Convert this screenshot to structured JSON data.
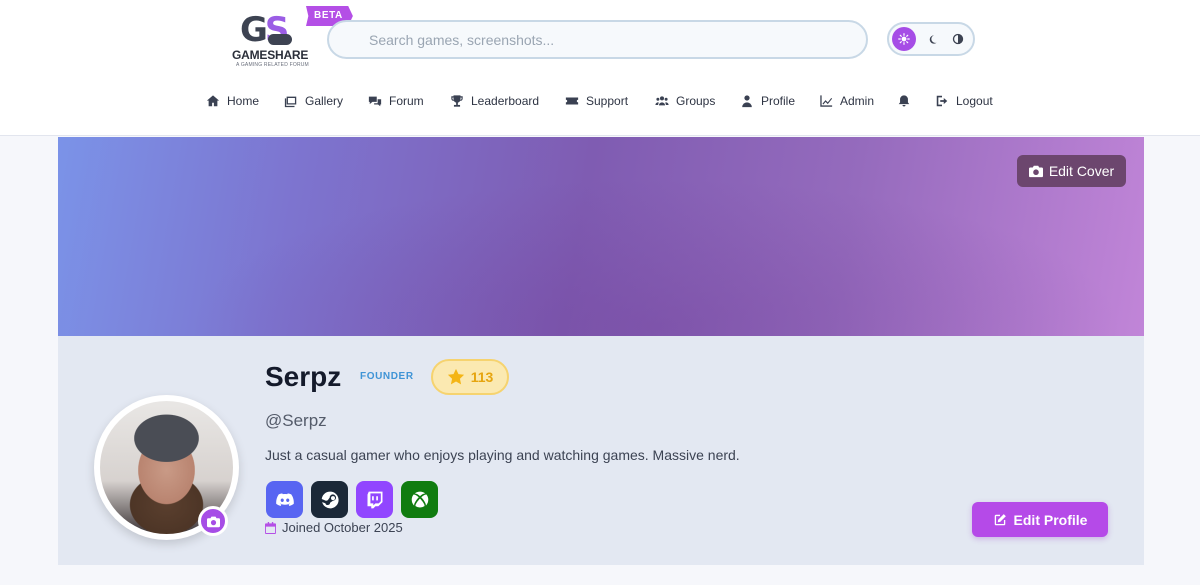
{
  "header": {
    "logo": {
      "mark": "GS",
      "name": "GAMESHARE",
      "tagline": "A GAMING RELATED FORUM"
    },
    "beta_badge": "BETA",
    "search": {
      "placeholder": "Search games, screenshots...",
      "value": ""
    },
    "theme_toggle": {
      "options": [
        "light",
        "dark",
        "auto"
      ],
      "selected": "light"
    }
  },
  "nav": {
    "items": [
      {
        "label": "Home",
        "icon": "home-icon"
      },
      {
        "label": "Gallery",
        "icon": "images-icon"
      },
      {
        "label": "Forum",
        "icon": "comments-icon"
      },
      {
        "label": "Leaderboard",
        "icon": "trophy-icon"
      },
      {
        "label": "Support",
        "icon": "ticket-icon"
      },
      {
        "label": "Groups",
        "icon": "users-icon"
      },
      {
        "label": "Profile",
        "icon": "user-icon"
      },
      {
        "label": "Admin",
        "icon": "chart-icon"
      },
      {
        "label": "",
        "icon": "bell-icon"
      },
      {
        "label": "Logout",
        "icon": "logout-icon"
      }
    ]
  },
  "cover": {
    "edit_label": "Edit Cover"
  },
  "profile": {
    "name": "Serpz",
    "role_badge": "FOUNDER",
    "points": "113",
    "handle": "@Serpz",
    "bio": "Just a casual gamer who enjoys playing and watching games. Massive nerd.",
    "social": [
      {
        "name": "discord",
        "color": "#5865f2"
      },
      {
        "name": "steam",
        "color": "#1b2838"
      },
      {
        "name": "twitch",
        "color": "#9146ff"
      },
      {
        "name": "xbox",
        "color": "#107c10"
      }
    ],
    "joined": "Joined October 2025",
    "edit_label": "Edit Profile"
  },
  "colors": {
    "accent": "#b54ae8",
    "founder": "#3f94d6",
    "points": "#f4b516"
  }
}
